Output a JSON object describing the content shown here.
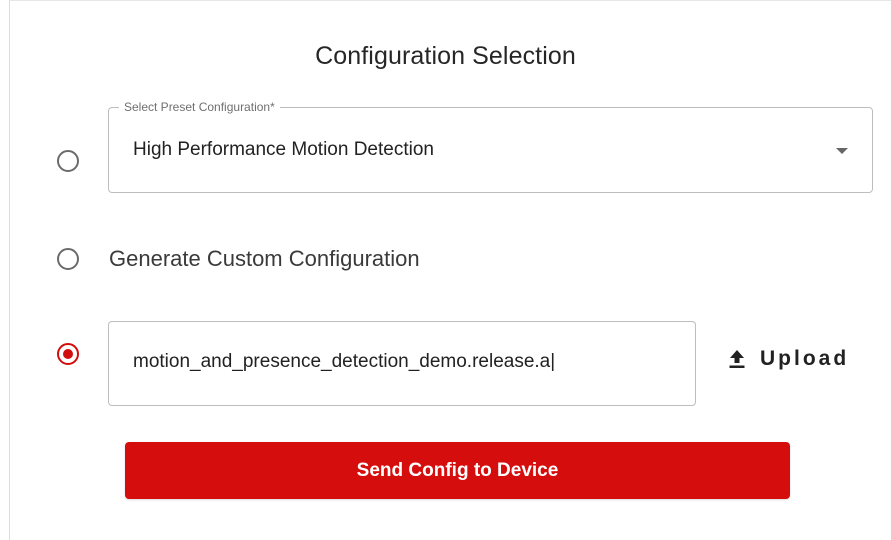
{
  "title": "Configuration Selection",
  "preset": {
    "label": "Select Preset Configuration",
    "required_mark": "*",
    "selected_value": "High Performance Motion Detection",
    "selected": false
  },
  "custom": {
    "label": "Generate Custom Configuration",
    "selected": false
  },
  "file": {
    "value": "motion_and_presence_detection_demo.release.a|",
    "selected": true,
    "upload_label": "Upload",
    "upload_icon": "upload-icon"
  },
  "send_button": {
    "label": "Send Config to Device"
  },
  "colors": {
    "accent": "#d60d0d",
    "radio_border": "#6b6b6b",
    "field_border": "#bdbdbd",
    "text": "#222222"
  }
}
